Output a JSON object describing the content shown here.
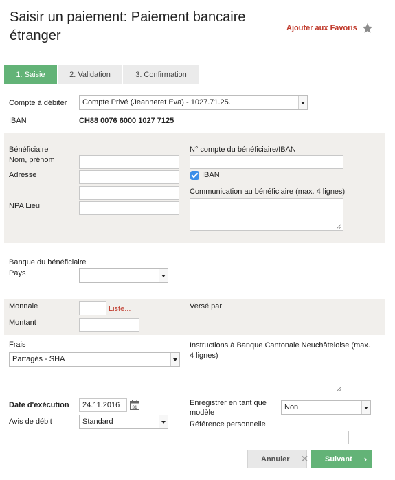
{
  "header": {
    "title": "Saisir un paiement: Paiement bancaire étranger",
    "favorites": "Ajouter aux Favoris"
  },
  "steps": [
    "1. Saisie",
    "2. Validation",
    "3. Confirmation"
  ],
  "debit": {
    "account_label": "Compte à débiter",
    "account_value": "Compte Privé (Jeanneret Eva) - 1027.71.25.",
    "iban_label": "IBAN",
    "iban_value": "CH88 0076 6000 1027 7125"
  },
  "beneficiary": {
    "section_label": "Bénéficiaire",
    "name_label": "Nom, prénom",
    "address_label": "Adresse",
    "npa_label": "NPA Lieu",
    "account_label": "N° compte du bénéficiaire/IBAN",
    "iban_checkbox_label": "IBAN",
    "iban_checked": true,
    "communication_label": "Communication au bénéficiaire (max. 4 lignes)"
  },
  "bank": {
    "section_label": "Banque du bénéficiaire",
    "country_label": "Pays",
    "country_value": ""
  },
  "amount": {
    "currency_label": "Monnaie",
    "list_link": "Liste...",
    "amount_label": "Montant",
    "paid_by_label": "Versé par"
  },
  "fees": {
    "label": "Frais",
    "value": "Partagés - SHA",
    "instructions_label": "Instructions à Banque Cantonale Neuchâteloise (max. 4 lignes)"
  },
  "execution": {
    "date_label": "Date d'exécution",
    "date_value": "24.11.2016",
    "notice_label": "Avis de débit",
    "notice_value": "Standard",
    "save_template_label": "Enregistrer en tant que modèle",
    "save_template_value": "Non",
    "personal_ref_label": "Référence personnelle"
  },
  "buttons": {
    "cancel": "Annuler",
    "next": "Suivant"
  },
  "colors": {
    "accent_green": "#63b377",
    "link_red": "#c0392b",
    "checkbox_blue": "#3b8ee8",
    "band_grey": "#f1efec"
  }
}
